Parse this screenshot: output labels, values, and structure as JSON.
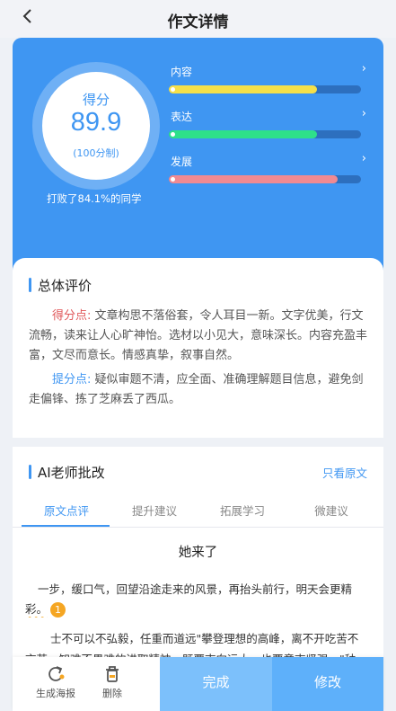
{
  "header": {
    "back_icon": "chevron-left-icon",
    "title": "作文详情"
  },
  "score": {
    "label": "得分",
    "value": "89.9",
    "scale": "(100分制)",
    "beat_text": "打败了84.1%的同学"
  },
  "metrics": [
    {
      "name": "内容",
      "level": 0.77,
      "color": "#f5e04a"
    },
    {
      "name": "表达",
      "level": 0.77,
      "color": "#2ee08a"
    },
    {
      "name": "发展",
      "level": 0.88,
      "color": "#f08a92"
    }
  ],
  "overall": {
    "title": "总体评价",
    "good_label": "得分点:",
    "good_text": "文章构思不落俗套，令人耳目一新。文字优美，行文流畅，读来让人心旷神怡。选材以小见大，意味深长。内容充盈丰富，文尽而意长。情感真挚，叙事自然。",
    "improve_label": "提分点:",
    "improve_text": "疑似审题不清，应全面、准确理解题目信息，避免剑走偏锋、拣了芝麻丢了西瓜。"
  },
  "ai_review": {
    "title": "AI老师批改",
    "only_original": "只看原文",
    "tabs": [
      "原文点评",
      "提升建议",
      "拓展学习",
      "微建议"
    ],
    "essay_title": "她来了",
    "line1": "一步，缓口气，回望沿途走来的风景，再抬头前行，明天会更精",
    "line2": "彩。",
    "badge": "1",
    "line3": "士不可以不弘毅，任重而道远\"攀登理想的高峰，离不开吃苦不",
    "line4": "言苦、知难不畏难的进取精神。既要志向远大，也要意志坚强。\"种"
  },
  "bottom": {
    "poster_label": "生成海报",
    "poster_icon": "refresh-share-icon",
    "delete_label": "删除",
    "delete_icon": "trash-icon",
    "done_label": "完成",
    "edit_label": "修改"
  }
}
